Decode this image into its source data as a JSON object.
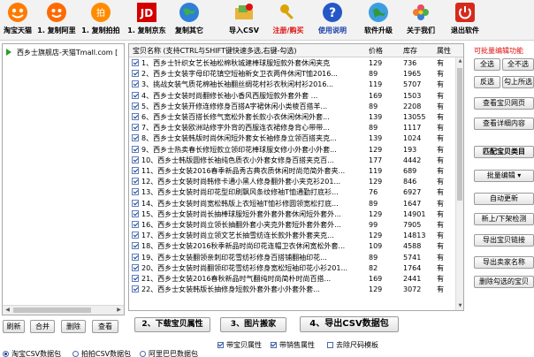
{
  "toolbar": {
    "items": [
      {
        "label": "淘宝天猫",
        "icon": "taobao-tmall-icon"
      },
      {
        "label": "1. 复制阿里",
        "icon": "alibaba-icon"
      },
      {
        "label": "1. 复制拍拍",
        "icon": "paipai-icon"
      },
      {
        "label": "1. 复制京东",
        "icon": "jd-icon"
      },
      {
        "label": "复制其它",
        "icon": "globe-icon"
      },
      {
        "label": "导入CSV",
        "icon": "folder-icon"
      },
      {
        "label": "注册/购买",
        "icon": "key-icon"
      },
      {
        "label": "使用说明",
        "icon": "help-icon"
      },
      {
        "label": "软件升级",
        "icon": "upgrade-icon"
      },
      {
        "label": "关于我们",
        "icon": "flower-icon"
      },
      {
        "label": "退出软件",
        "icon": "power-icon"
      }
    ],
    "colors": {
      "register": "#e01010",
      "help": "#1a3fa8"
    }
  },
  "tree": {
    "item": "西乡士旗舰店-天猫Tmall.com ["
  },
  "table": {
    "headers": {
      "name": "宝贝名称 (支持CTRL与SHIFT键快速多选,右键-勾选)",
      "price": "价格",
      "stock": "库存",
      "attr": "属性"
    },
    "rows": [
      {
        "name": "西乡士针织女艺长袖松棉秋城建棒球服短款外套休闲夹克",
        "price": "129",
        "stock": "736",
        "attr": "有"
      },
      {
        "name": "西乡士女装字母印花镇空短袖新女卫衣两件休闲T恤2016...",
        "price": "89",
        "stock": "1965",
        "attr": "有"
      },
      {
        "name": "挑战女装气质花棉袖长袖翻丝绸花村衫衣秋闲村衫2016...",
        "price": "119",
        "stock": "5707",
        "attr": "有"
      },
      {
        "name": "西乡士女装时尚翻修长袖小香风西服短款外套外套 ...",
        "price": "169",
        "stock": "1503",
        "attr": "有"
      },
      {
        "name": "西乡士女装开修连修修身百搭A字裙休闲小类棱百搭羊...",
        "price": "89",
        "stock": "2208",
        "am": "",
        "attr": "有"
      },
      {
        "name": "西乡士女装百搭长修气宽松外套长款小衣休闲休闲外套...",
        "price": "139",
        "stock": "13055",
        "attr": "有"
      },
      {
        "name": "西乡士女装欧洲站修字外背的西服连衣裙修身背心带带...",
        "price": "89",
        "stock": "1117",
        "attr": "有"
      },
      {
        "name": "西乡士女装韩版时尚休闲短外套女长袖修身立领百搭夹克...",
        "price": "139",
        "stock": "1024",
        "attr": "有"
      },
      {
        "name": "西乡士热卖春长修短款立领印花棒球服女修小外套小外套...",
        "price": "129",
        "stock": "193",
        "attr": "有"
      },
      {
        "name": "西乡士韩版圆修长袖纯色质衣小外套女修身百搭夹克百...",
        "price": "177",
        "stock": "4442",
        "attr": "有"
      },
      {
        "name": "西乡士女装2016春季新品秀古典衣质休闲时尚范简外套夹...",
        "price": "119",
        "stock": "689",
        "attr": "有"
      },
      {
        "name": "西乡士女装时尚韩修卡通小黑人修身翻外套小夹克衫201...",
        "price": "129",
        "stock": "846",
        "attr": "有"
      },
      {
        "name": "西乡士女装时尚印花型印刷飘风条纹修袖T恤通勤打底衫...",
        "price": "76",
        "stock": "6927",
        "attr": "有"
      },
      {
        "name": "西乡士女装时尚宽松韩版上衣短袖T恤衫修圆领宽松打底...",
        "price": "89",
        "stock": "1647",
        "attr": "有"
      },
      {
        "name": "西乡士女装时尚长抽棒球服短外套外套外套休闲短外套外...",
        "price": "129",
        "stock": "14901",
        "attr": "有"
      },
      {
        "name": "西乡士女装时尚立领长抽翻外套小夹克外套短外套外套外...",
        "price": "99",
        "stock": "7905",
        "attr": "有"
      },
      {
        "name": "西乡士女装时尚立领文艺长抽雪纺连长款外套外套夹克...",
        "price": "129",
        "stock": "14813",
        "attr": "有"
      },
      {
        "name": "西乡士女装2016秋季新品时尚印花连帽卫衣休闲宽松外套...",
        "price": "109",
        "stock": "4588",
        "attr": "有"
      },
      {
        "name": "西乡士女装翻领亲刺印花雪纺衫修身百搭铺翻袖印花...",
        "price": "89",
        "stock": "5741",
        "attr": "有"
      },
      {
        "name": "西乡士女装时尚翻领印花雪纺衫修身宽松短袖印花小衫201...",
        "price": "82",
        "stock": "1764",
        "attr": "有"
      },
      {
        "name": "西乡士女装2016春秋新品时气翻纯时尚简朴时尚百搭...",
        "price": "169",
        "stock": "2441",
        "attr": "有"
      },
      {
        "name": "西乡士女装韩版长抽修身短款外套外套小外套外套...",
        "price": "129",
        "stock": "3072",
        "attr": "有"
      }
    ]
  },
  "right_panel": {
    "title": "可批量编辑功能",
    "buttons": {
      "select_all": "全选",
      "select_none": "全不选",
      "invert": "反选",
      "check_above": "勾上所选",
      "view_page": "查看宝贝网页",
      "view_detail": "查看详细内容",
      "match_category": "匹配宝贝类目",
      "batch_edit": "批量编辑",
      "auto_update": "自动更新",
      "new_shelf_check": "新上/下架检测",
      "export_link": "导出宝贝链接",
      "export_seller": "导出卖家名称",
      "delete_checked": "删除勾选的宝贝"
    }
  },
  "bottom": {
    "left_buttons": {
      "refresh": "刷新",
      "merge": "合并",
      "delete": "删除",
      "view": "查看"
    },
    "actions": {
      "download_attrs": "2、下载宝贝属性",
      "image_move": "3、图片搬家",
      "export_csv": "4、导出CSV数据包"
    },
    "options": {
      "taobao_csv": "淘宝CSV数据包",
      "paipai_csv": "拍拍CSV数据包",
      "alibaba_csv": "阿里巴巴数据包",
      "with_attrs": "带宝贝属性",
      "with_sku": "带销售属性",
      "remove_size_template": "去除尺码模板"
    }
  }
}
